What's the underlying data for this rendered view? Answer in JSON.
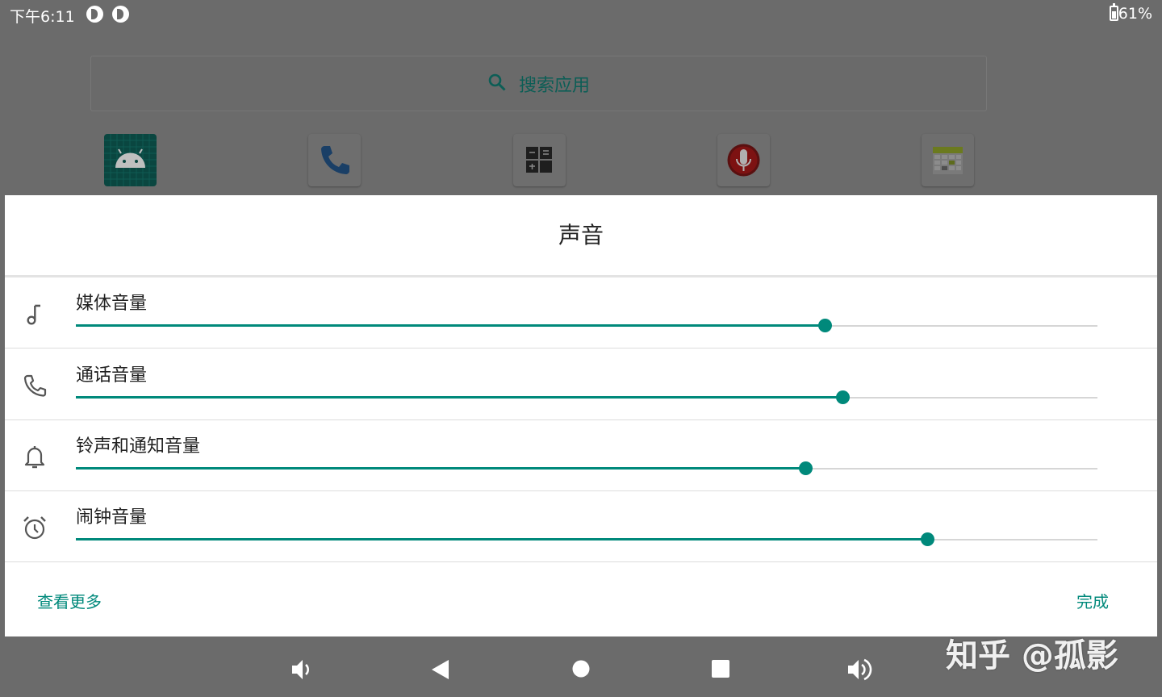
{
  "status_bar": {
    "time": "下午6:11",
    "battery_percent": "61%",
    "battery_level": 0.61
  },
  "launcher": {
    "search_label": "搜索应用",
    "apps": [
      "android-icon",
      "phone-icon",
      "calculator-icon",
      "sound-recorder-icon",
      "calendar-icon"
    ]
  },
  "dialog": {
    "title": "声音",
    "rows": [
      {
        "label": "媒体音量",
        "icon": "music-note-icon",
        "value": 0.733
      },
      {
        "label": "通话音量",
        "icon": "phone-icon",
        "value": 0.75
      },
      {
        "label": "铃声和通知音量",
        "icon": "bell-icon",
        "value": 0.714
      },
      {
        "label": "闹钟音量",
        "icon": "alarm-icon",
        "value": 0.833
      }
    ],
    "more_label": "查看更多",
    "done_label": "完成"
  },
  "nav_bar": {
    "buttons": [
      "volume-down-icon",
      "back-icon",
      "home-icon",
      "recents-icon",
      "volume-up-icon"
    ]
  },
  "watermark": "知乎 @孤影",
  "colors": {
    "accent": "#00897b",
    "scrim": "#6b6b6b",
    "dialog_bg": "#ffffff"
  }
}
